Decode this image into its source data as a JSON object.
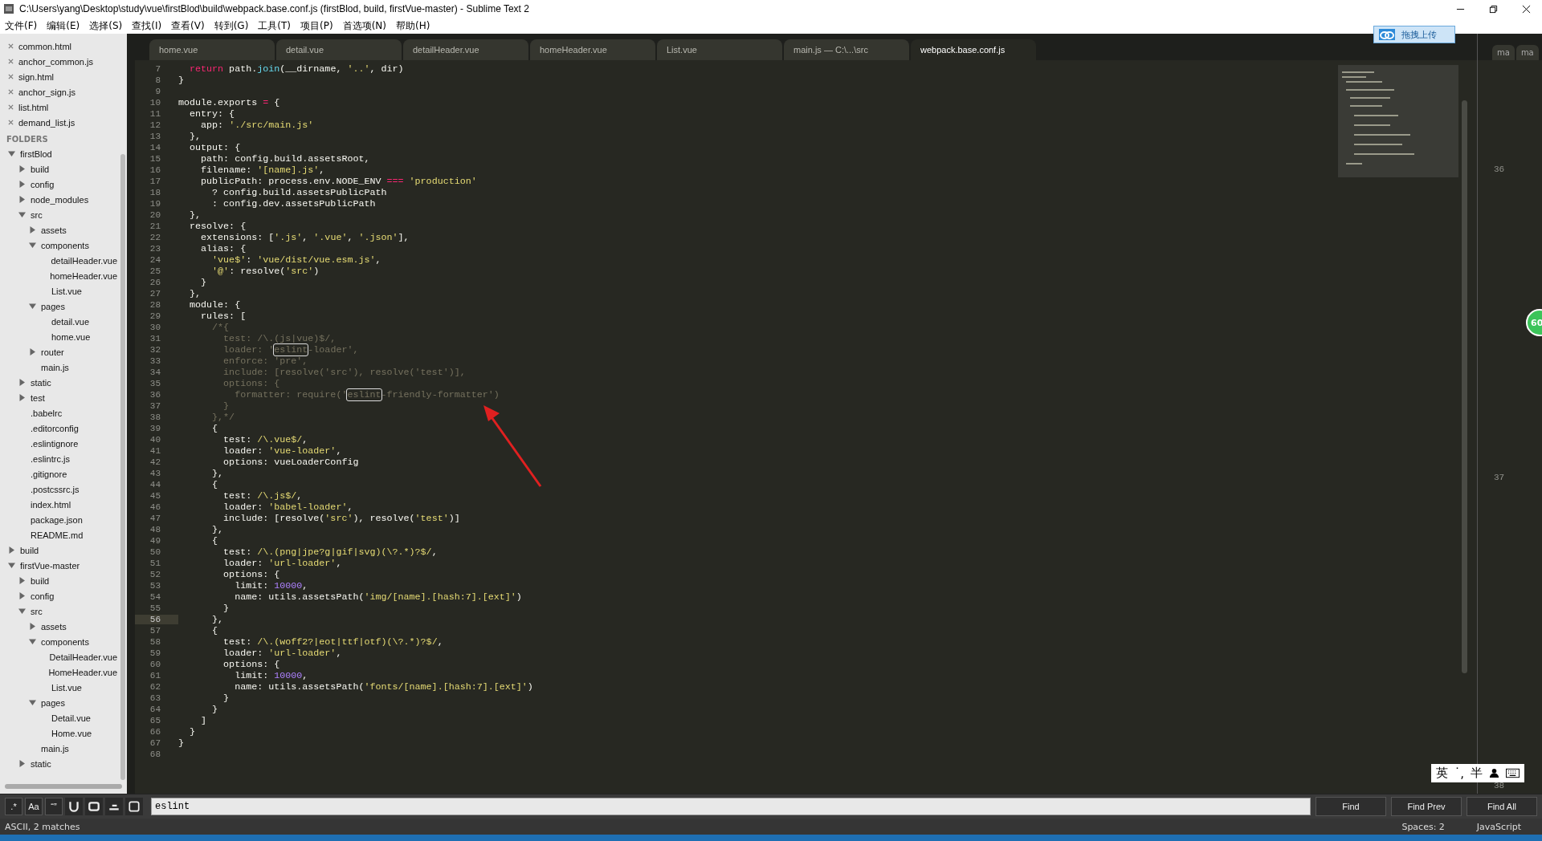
{
  "window": {
    "title": "C:\\Users\\yang\\Desktop\\study\\vue\\firstBlod\\build\\webpack.base.conf.js (firstBlod, build, firstVue-master) - Sublime Text 2"
  },
  "menu": [
    "文件(F)",
    "编辑(E)",
    "选择(S)",
    "查找(I)",
    "查看(V)",
    "转到(G)",
    "工具(T)",
    "项目(P)",
    "首选项(N)",
    "帮助(H)"
  ],
  "upload_button": "拖拽上传",
  "tabs": [
    {
      "label": "home.vue",
      "selected": false
    },
    {
      "label": "detail.vue",
      "selected": false
    },
    {
      "label": "detailHeader.vue",
      "selected": false
    },
    {
      "label": "homeHeader.vue",
      "selected": false
    },
    {
      "label": "List.vue",
      "selected": false
    },
    {
      "label": "main.js — C:\\...\\src",
      "selected": false
    },
    {
      "label": "webpack.base.conf.js",
      "selected": true
    }
  ],
  "sidebar": {
    "open_files": [
      "common.html",
      "anchor_common.js",
      "sign.html",
      "anchor_sign.js",
      "list.html",
      "demand_list.js"
    ],
    "folders_heading": "FOLDERS",
    "folders": [
      {
        "label": "firstBlod",
        "kind": "folder",
        "expanded": true,
        "children": [
          {
            "label": "build",
            "kind": "folder",
            "expanded": false
          },
          {
            "label": "config",
            "kind": "folder",
            "expanded": false
          },
          {
            "label": "node_modules",
            "kind": "folder",
            "expanded": false
          },
          {
            "label": "src",
            "kind": "folder",
            "expanded": true,
            "children": [
              {
                "label": "assets",
                "kind": "folder",
                "expanded": false
              },
              {
                "label": "components",
                "kind": "folder",
                "expanded": true,
                "children": [
                  {
                    "label": "detailHeader.vue",
                    "kind": "file"
                  },
                  {
                    "label": "homeHeader.vue",
                    "kind": "file"
                  },
                  {
                    "label": "List.vue",
                    "kind": "file"
                  }
                ]
              },
              {
                "label": "pages",
                "kind": "folder",
                "expanded": true,
                "children": [
                  {
                    "label": "detail.vue",
                    "kind": "file"
                  },
                  {
                    "label": "home.vue",
                    "kind": "file"
                  }
                ]
              },
              {
                "label": "router",
                "kind": "folder",
                "expanded": false
              },
              {
                "label": "main.js",
                "kind": "file"
              }
            ]
          },
          {
            "label": "static",
            "kind": "folder",
            "expanded": false
          },
          {
            "label": "test",
            "kind": "folder",
            "expanded": false
          },
          {
            "label": ".babelrc",
            "kind": "file"
          },
          {
            "label": ".editorconfig",
            "kind": "file"
          },
          {
            "label": ".eslintignore",
            "kind": "file"
          },
          {
            "label": ".eslintrc.js",
            "kind": "file"
          },
          {
            "label": ".gitignore",
            "kind": "file"
          },
          {
            "label": ".postcssrc.js",
            "kind": "file"
          },
          {
            "label": "index.html",
            "kind": "file"
          },
          {
            "label": "package.json",
            "kind": "file"
          },
          {
            "label": "README.md",
            "kind": "file"
          }
        ]
      },
      {
        "label": "build",
        "kind": "folder",
        "expanded": false
      },
      {
        "label": "firstVue-master",
        "kind": "folder",
        "expanded": true,
        "children": [
          {
            "label": "build",
            "kind": "folder",
            "expanded": false
          },
          {
            "label": "config",
            "kind": "folder",
            "expanded": false
          },
          {
            "label": "src",
            "kind": "folder",
            "expanded": true,
            "children": [
              {
                "label": "assets",
                "kind": "folder",
                "expanded": false
              },
              {
                "label": "components",
                "kind": "folder",
                "expanded": true,
                "children": [
                  {
                    "label": "DetailHeader.vue",
                    "kind": "file"
                  },
                  {
                    "label": "HomeHeader.vue",
                    "kind": "file"
                  },
                  {
                    "label": "List.vue",
                    "kind": "file"
                  }
                ]
              },
              {
                "label": "pages",
                "kind": "folder",
                "expanded": true,
                "children": [
                  {
                    "label": "Detail.vue",
                    "kind": "file"
                  },
                  {
                    "label": "Home.vue",
                    "kind": "file"
                  }
                ]
              },
              {
                "label": "main.js",
                "kind": "file"
              }
            ]
          },
          {
            "label": "static",
            "kind": "folder",
            "expanded": false
          }
        ]
      }
    ]
  },
  "editor": {
    "lines": [
      {
        "n": "7",
        "current": false,
        "segs": [
          {
            "kind": "keyword",
            "text": "  return"
          },
          {
            "kind": "plain",
            "text": " path."
          },
          {
            "kind": "function",
            "text": "join"
          },
          {
            "kind": "plain",
            "text": "(__dirname, "
          },
          {
            "kind": "string",
            "text": "'..'"
          },
          {
            "kind": "plain",
            "text": ", dir)"
          }
        ]
      },
      {
        "n": "8",
        "current": false,
        "segs": [
          {
            "kind": "plain",
            "text": "}"
          }
        ]
      },
      {
        "n": "9",
        "current": false
      },
      {
        "n": "10",
        "current": false,
        "segs": [
          {
            "kind": "plain",
            "text": "module.exports "
          },
          {
            "kind": "keyword",
            "text": "="
          },
          {
            "kind": "plain",
            "text": " {"
          }
        ]
      },
      {
        "n": "11",
        "current": false,
        "segs": [
          {
            "kind": "plain",
            "text": "  entry: {"
          }
        ]
      },
      {
        "n": "12",
        "current": false,
        "segs": [
          {
            "kind": "plain",
            "text": "    app: "
          },
          {
            "kind": "string",
            "text": "'./src/main.js'"
          }
        ]
      },
      {
        "n": "13",
        "current": false,
        "segs": [
          {
            "kind": "plain",
            "text": "  },"
          }
        ]
      },
      {
        "n": "14",
        "current": false,
        "segs": [
          {
            "kind": "plain",
            "text": "  output: {"
          }
        ]
      },
      {
        "n": "15",
        "current": false,
        "segs": [
          {
            "kind": "plain",
            "text": "    path: config.build.assetsRoot,"
          }
        ]
      },
      {
        "n": "16",
        "current": false,
        "segs": [
          {
            "kind": "plain",
            "text": "    filename: "
          },
          {
            "kind": "string",
            "text": "'[name].js'"
          },
          {
            "kind": "plain",
            "text": ","
          }
        ]
      },
      {
        "n": "17",
        "current": false,
        "segs": [
          {
            "kind": "plain",
            "text": "    publicPath: process.env.NODE_ENV "
          },
          {
            "kind": "keyword",
            "text": "==="
          },
          {
            "kind": "string",
            "text": " 'production'"
          }
        ]
      },
      {
        "n": "18",
        "current": false,
        "segs": [
          {
            "kind": "plain",
            "text": "      ? config.build.assetsPublicPath"
          }
        ]
      },
      {
        "n": "19",
        "current": false,
        "segs": [
          {
            "kind": "plain",
            "text": "      : config.dev.assetsPublicPath"
          }
        ]
      },
      {
        "n": "20",
        "current": false,
        "segs": [
          {
            "kind": "plain",
            "text": "  },"
          }
        ]
      },
      {
        "n": "21",
        "current": false,
        "segs": [
          {
            "kind": "plain",
            "text": "  resolve: {"
          }
        ]
      },
      {
        "n": "22",
        "current": false,
        "segs": [
          {
            "kind": "plain",
            "text": "    extensions: ["
          },
          {
            "kind": "string",
            "text": "'.js'"
          },
          {
            "kind": "plain",
            "text": ", "
          },
          {
            "kind": "string",
            "text": "'.vue'"
          },
          {
            "kind": "plain",
            "text": ", "
          },
          {
            "kind": "string",
            "text": "'.json'"
          },
          {
            "kind": "plain",
            "text": "],"
          }
        ]
      },
      {
        "n": "23",
        "current": false,
        "segs": [
          {
            "kind": "plain",
            "text": "    alias: {"
          }
        ]
      },
      {
        "n": "24",
        "current": false,
        "segs": [
          {
            "kind": "string",
            "text": "      'vue$'"
          },
          {
            "kind": "plain",
            "text": ": "
          },
          {
            "kind": "string",
            "text": "'vue/dist/vue.esm.js'"
          },
          {
            "kind": "plain",
            "text": ","
          }
        ]
      },
      {
        "n": "25",
        "current": false,
        "segs": [
          {
            "kind": "string",
            "text": "      '@'"
          },
          {
            "kind": "plain",
            "text": ": resolve("
          },
          {
            "kind": "string",
            "text": "'src'"
          },
          {
            "kind": "plain",
            "text": ")"
          }
        ]
      },
      {
        "n": "26",
        "current": false,
        "segs": [
          {
            "kind": "plain",
            "text": "    }"
          }
        ]
      },
      {
        "n": "27",
        "current": false,
        "segs": [
          {
            "kind": "plain",
            "text": "  },"
          }
        ]
      },
      {
        "n": "28",
        "current": false,
        "segs": [
          {
            "kind": "plain",
            "text": "  module: {"
          }
        ]
      },
      {
        "n": "29",
        "current": false,
        "segs": [
          {
            "kind": "plain",
            "text": "    rules: ["
          }
        ]
      },
      {
        "n": "30",
        "current": false,
        "segs": [
          {
            "kind": "comment",
            "text": "      /*{"
          }
        ]
      },
      {
        "n": "31",
        "current": false,
        "segs": [
          {
            "kind": "comment",
            "text": "        test: /\\.(js|vue)$/,"
          }
        ]
      },
      {
        "n": "32",
        "current": false,
        "segs": [
          {
            "kind": "comment",
            "text": "        loader: '"
          },
          {
            "kind": "match",
            "text": "eslint"
          },
          {
            "kind": "comment",
            "text": "-loader',"
          }
        ]
      },
      {
        "n": "33",
        "current": false,
        "segs": [
          {
            "kind": "comment",
            "text": "        enforce: 'pre',"
          }
        ]
      },
      {
        "n": "34",
        "current": false,
        "segs": [
          {
            "kind": "comment",
            "text": "        include: [resolve('src'), resolve('test')],"
          }
        ]
      },
      {
        "n": "35",
        "current": false,
        "segs": [
          {
            "kind": "comment",
            "text": "        options: {"
          }
        ]
      },
      {
        "n": "36",
        "current": false,
        "segs": [
          {
            "kind": "comment",
            "text": "          formatter: require('"
          },
          {
            "kind": "match",
            "text": "eslint"
          },
          {
            "kind": "comment",
            "text": "-friendly-formatter')"
          }
        ]
      },
      {
        "n": "37",
        "current": false,
        "segs": [
          {
            "kind": "comment",
            "text": "        }"
          }
        ]
      },
      {
        "n": "38",
        "current": false,
        "segs": [
          {
            "kind": "comment",
            "text": "      },*/"
          }
        ]
      },
      {
        "n": "39",
        "current": false,
        "segs": [
          {
            "kind": "plain",
            "text": "      {"
          }
        ]
      },
      {
        "n": "40",
        "current": false,
        "segs": [
          {
            "kind": "plain",
            "text": "        test: "
          },
          {
            "kind": "string",
            "text": "/\\.vue$/"
          },
          {
            "kind": "plain",
            "text": ","
          }
        ]
      },
      {
        "n": "41",
        "current": false,
        "segs": [
          {
            "kind": "plain",
            "text": "        loader: "
          },
          {
            "kind": "string",
            "text": "'vue-loader'"
          },
          {
            "kind": "plain",
            "text": ","
          }
        ]
      },
      {
        "n": "42",
        "current": false,
        "segs": [
          {
            "kind": "plain",
            "text": "        options: vueLoaderConfig"
          }
        ]
      },
      {
        "n": "43",
        "current": false,
        "segs": [
          {
            "kind": "plain",
            "text": "      },"
          }
        ]
      },
      {
        "n": "44",
        "current": false,
        "segs": [
          {
            "kind": "plain",
            "text": "      {"
          }
        ]
      },
      {
        "n": "45",
        "current": false,
        "segs": [
          {
            "kind": "plain",
            "text": "        test: "
          },
          {
            "kind": "string",
            "text": "/\\.js$/"
          },
          {
            "kind": "plain",
            "text": ","
          }
        ]
      },
      {
        "n": "46",
        "current": false,
        "segs": [
          {
            "kind": "plain",
            "text": "        loader: "
          },
          {
            "kind": "string",
            "text": "'babel-loader'"
          },
          {
            "kind": "plain",
            "text": ","
          }
        ]
      },
      {
        "n": "47",
        "current": false,
        "segs": [
          {
            "kind": "plain",
            "text": "        include: [resolve("
          },
          {
            "kind": "string",
            "text": "'src'"
          },
          {
            "kind": "plain",
            "text": "), resolve("
          },
          {
            "kind": "string",
            "text": "'test'"
          },
          {
            "kind": "plain",
            "text": ")]"
          }
        ]
      },
      {
        "n": "48",
        "current": false,
        "segs": [
          {
            "kind": "plain",
            "text": "      },"
          }
        ]
      },
      {
        "n": "49",
        "current": false,
        "segs": [
          {
            "kind": "plain",
            "text": "      {"
          }
        ]
      },
      {
        "n": "50",
        "current": false,
        "segs": [
          {
            "kind": "plain",
            "text": "        test: "
          },
          {
            "kind": "string",
            "text": "/\\.(png|jpe?g|gif|svg)(\\?.*)?$/"
          },
          {
            "kind": "plain",
            "text": ","
          }
        ]
      },
      {
        "n": "51",
        "current": false,
        "segs": [
          {
            "kind": "plain",
            "text": "        loader: "
          },
          {
            "kind": "string",
            "text": "'url-loader'"
          },
          {
            "kind": "plain",
            "text": ","
          }
        ]
      },
      {
        "n": "52",
        "current": false,
        "segs": [
          {
            "kind": "plain",
            "text": "        options: {"
          }
        ]
      },
      {
        "n": "53",
        "current": false,
        "segs": [
          {
            "kind": "plain",
            "text": "          limit: "
          },
          {
            "kind": "number",
            "text": "10000"
          },
          {
            "kind": "plain",
            "text": ","
          }
        ]
      },
      {
        "n": "54",
        "current": false,
        "segs": [
          {
            "kind": "plain",
            "text": "          name: utils.assetsPath("
          },
          {
            "kind": "string",
            "text": "'img/[name].[hash:7].[ext]'"
          },
          {
            "kind": "plain",
            "text": ")"
          }
        ]
      },
      {
        "n": "55",
        "current": false,
        "segs": [
          {
            "kind": "plain",
            "text": "        }"
          }
        ]
      },
      {
        "n": "56",
        "current": true,
        "segs": [
          {
            "kind": "plain",
            "text": "      },"
          }
        ]
      },
      {
        "n": "57",
        "current": false,
        "segs": [
          {
            "kind": "plain",
            "text": "      {"
          }
        ]
      },
      {
        "n": "58",
        "current": false,
        "segs": [
          {
            "kind": "plain",
            "text": "        test: "
          },
          {
            "kind": "string",
            "text": "/\\.(woff2?|eot|ttf|otf)(\\?.*)?$/"
          },
          {
            "kind": "plain",
            "text": ","
          }
        ]
      },
      {
        "n": "59",
        "current": false,
        "segs": [
          {
            "kind": "plain",
            "text": "        loader: "
          },
          {
            "kind": "string",
            "text": "'url-loader'"
          },
          {
            "kind": "plain",
            "text": ","
          }
        ]
      },
      {
        "n": "60",
        "current": false,
        "segs": [
          {
            "kind": "plain",
            "text": "        options: {"
          }
        ]
      },
      {
        "n": "61",
        "current": false,
        "segs": [
          {
            "kind": "plain",
            "text": "          limit: "
          },
          {
            "kind": "number",
            "text": "10000"
          },
          {
            "kind": "plain",
            "text": ","
          }
        ]
      },
      {
        "n": "62",
        "current": false,
        "segs": [
          {
            "kind": "plain",
            "text": "          name: utils.assetsPath("
          },
          {
            "kind": "string",
            "text": "'fonts/[name].[hash:7].[ext]'"
          },
          {
            "kind": "plain",
            "text": ")"
          }
        ]
      },
      {
        "n": "63",
        "current": false,
        "segs": [
          {
            "kind": "plain",
            "text": "        }"
          }
        ]
      },
      {
        "n": "64",
        "current": false,
        "segs": [
          {
            "kind": "plain",
            "text": "      }"
          }
        ]
      },
      {
        "n": "65",
        "current": false,
        "segs": [
          {
            "kind": "plain",
            "text": "    ]"
          }
        ]
      },
      {
        "n": "66",
        "current": false,
        "segs": [
          {
            "kind": "plain",
            "text": "  }"
          }
        ]
      },
      {
        "n": "67",
        "current": false,
        "segs": [
          {
            "kind": "plain",
            "text": "}"
          }
        ]
      },
      {
        "n": "68",
        "current": false
      }
    ]
  },
  "right_pane": {
    "tabs": [
      "ma",
      "ma"
    ],
    "line_numbers": [
      "36",
      "37",
      "38"
    ]
  },
  "badge": "60",
  "ime_bar": [
    "英",
    "˙,",
    "半"
  ],
  "find_bar": {
    "toggles": [
      ".*",
      "Aa",
      "“”"
    ],
    "query": "eslint",
    "buttons": [
      "Find",
      "Find Prev",
      "Find All"
    ]
  },
  "status_bar": {
    "left": "ASCII, 2 matches",
    "indent": "Spaces: 2",
    "syntax": "JavaScript"
  }
}
